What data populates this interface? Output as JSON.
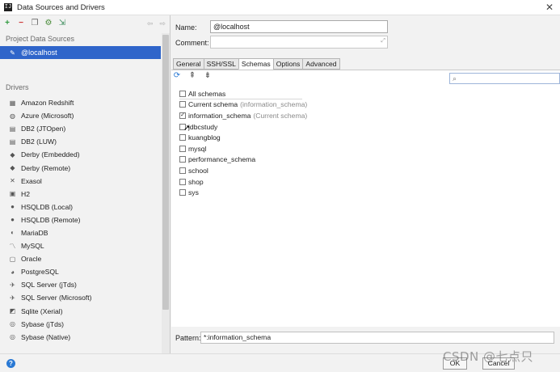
{
  "window": {
    "title": "Data Sources and Drivers",
    "app_icon_text": "IJ"
  },
  "left": {
    "project_section": "Project Data Sources",
    "selected_source": "@localhost",
    "drivers_section": "Drivers",
    "drivers": [
      {
        "label": "Amazon Redshift",
        "icon": "redshift-icon"
      },
      {
        "label": "Azure (Microsoft)",
        "icon": "azure-icon"
      },
      {
        "label": "DB2 (JTOpen)",
        "icon": "db2-icon"
      },
      {
        "label": "DB2 (LUW)",
        "icon": "db2-icon"
      },
      {
        "label": "Derby (Embedded)",
        "icon": "derby-icon"
      },
      {
        "label": "Derby (Remote)",
        "icon": "derby-icon"
      },
      {
        "label": "Exasol",
        "icon": "exasol-icon"
      },
      {
        "label": "H2",
        "icon": "h2-icon"
      },
      {
        "label": "HSQLDB (Local)",
        "icon": "hsqldb-icon"
      },
      {
        "label": "HSQLDB (Remote)",
        "icon": "hsqldb-icon"
      },
      {
        "label": "MariaDB",
        "icon": "mariadb-icon"
      },
      {
        "label": "MySQL",
        "icon": "mysql-icon"
      },
      {
        "label": "Oracle",
        "icon": "oracle-icon"
      },
      {
        "label": "PostgreSQL",
        "icon": "postgresql-icon"
      },
      {
        "label": "SQL Server (jTds)",
        "icon": "sqlserver-icon"
      },
      {
        "label": "SQL Server (Microsoft)",
        "icon": "sqlserver-icon"
      },
      {
        "label": "Sqlite (Xerial)",
        "icon": "sqlite-icon"
      },
      {
        "label": "Sybase (jTds)",
        "icon": "sybase-icon"
      },
      {
        "label": "Sybase (Native)",
        "icon": "sybase-icon"
      }
    ]
  },
  "form": {
    "name_label": "Name:",
    "name_value": "@localhost",
    "comment_label": "Comment:",
    "comment_value": ""
  },
  "tabs": [
    {
      "label": "General",
      "active": false
    },
    {
      "label": "SSH/SSL",
      "active": false
    },
    {
      "label": "Schemas",
      "active": true
    },
    {
      "label": "Options",
      "active": false
    },
    {
      "label": "Advanced",
      "active": false
    }
  ],
  "schemas": [
    {
      "label": "All schemas",
      "hint": "",
      "checked": false
    },
    {
      "label": "Current schema",
      "hint": "(information_schema)",
      "checked": false
    },
    {
      "label": "information_schema",
      "hint": "(Current schema)",
      "checked": true
    },
    {
      "label": "jdbcstudy",
      "hint": "",
      "checked": false
    },
    {
      "label": "kuangblog",
      "hint": "",
      "checked": false
    },
    {
      "label": "mysql",
      "hint": "",
      "checked": false
    },
    {
      "label": "performance_schema",
      "hint": "",
      "checked": false
    },
    {
      "label": "school",
      "hint": "",
      "checked": false
    },
    {
      "label": "shop",
      "hint": "",
      "checked": false
    },
    {
      "label": "sys",
      "hint": "",
      "checked": false
    }
  ],
  "pattern": {
    "label": "Pattern:",
    "value": "*:information_schema"
  },
  "buttons": {
    "ok": "OK",
    "cancel": "Cancel"
  },
  "watermark": "CSDN @七点只",
  "colors": {
    "selection": "#2f65ca",
    "help": "#2a79d4"
  }
}
